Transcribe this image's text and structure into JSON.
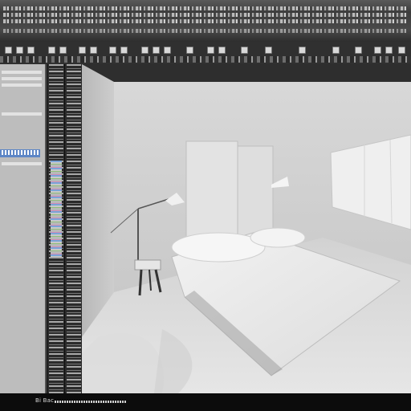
{
  "statusbar": {
    "text": "Bi Bac"
  },
  "icons": {
    "menu": "menu-strip-icon",
    "tool": "tool-icon"
  },
  "colors": {
    "background": "#222222",
    "panel": "#bdbdbd",
    "selection": "#5d86c6",
    "viewport_wall": "#d2d2d2",
    "ceiling_band": "#2e2e2e"
  },
  "scene": {
    "objects": [
      "bed",
      "floor-lamp",
      "wall-lamp",
      "stool",
      "headboard-panels",
      "window"
    ]
  }
}
